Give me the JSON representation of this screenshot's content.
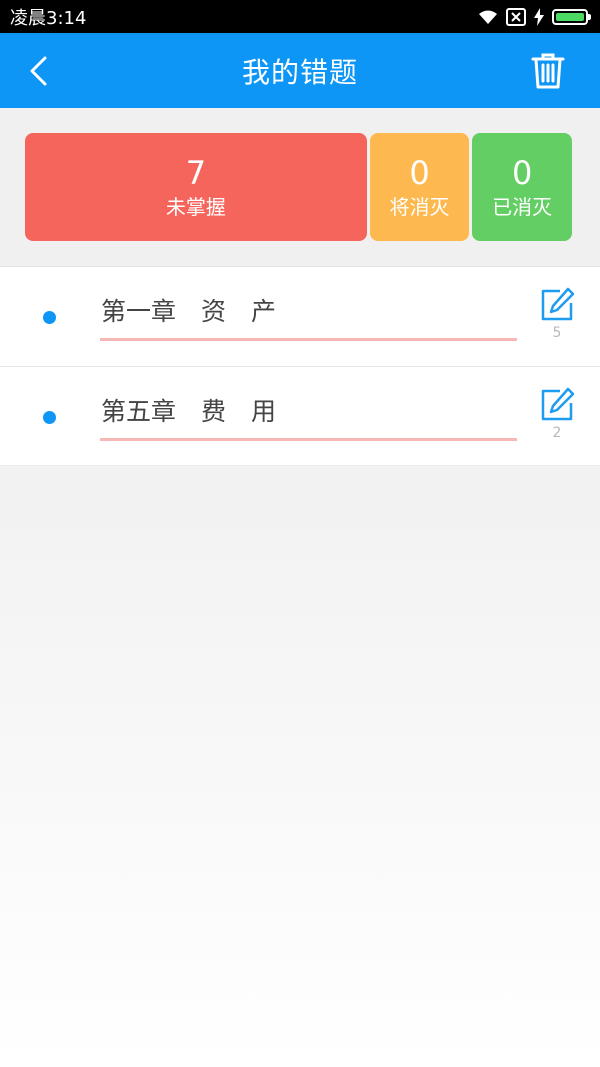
{
  "status_bar": {
    "time": "凌晨3:14"
  },
  "header": {
    "title": "我的错题"
  },
  "stats": [
    {
      "value": "7",
      "label": "未掌握",
      "color": "#f5655c"
    },
    {
      "value": "0",
      "label": "将消灭",
      "color": "#fdb94f"
    },
    {
      "value": "0",
      "label": "已消灭",
      "color": "#63ce63"
    }
  ],
  "chapters": [
    {
      "title": "第一章　资　产",
      "count": "5"
    },
    {
      "title": "第五章　费　用",
      "count": "2"
    }
  ],
  "colors": {
    "primary": "#0d96f5",
    "underline": "#f7b7b5"
  }
}
